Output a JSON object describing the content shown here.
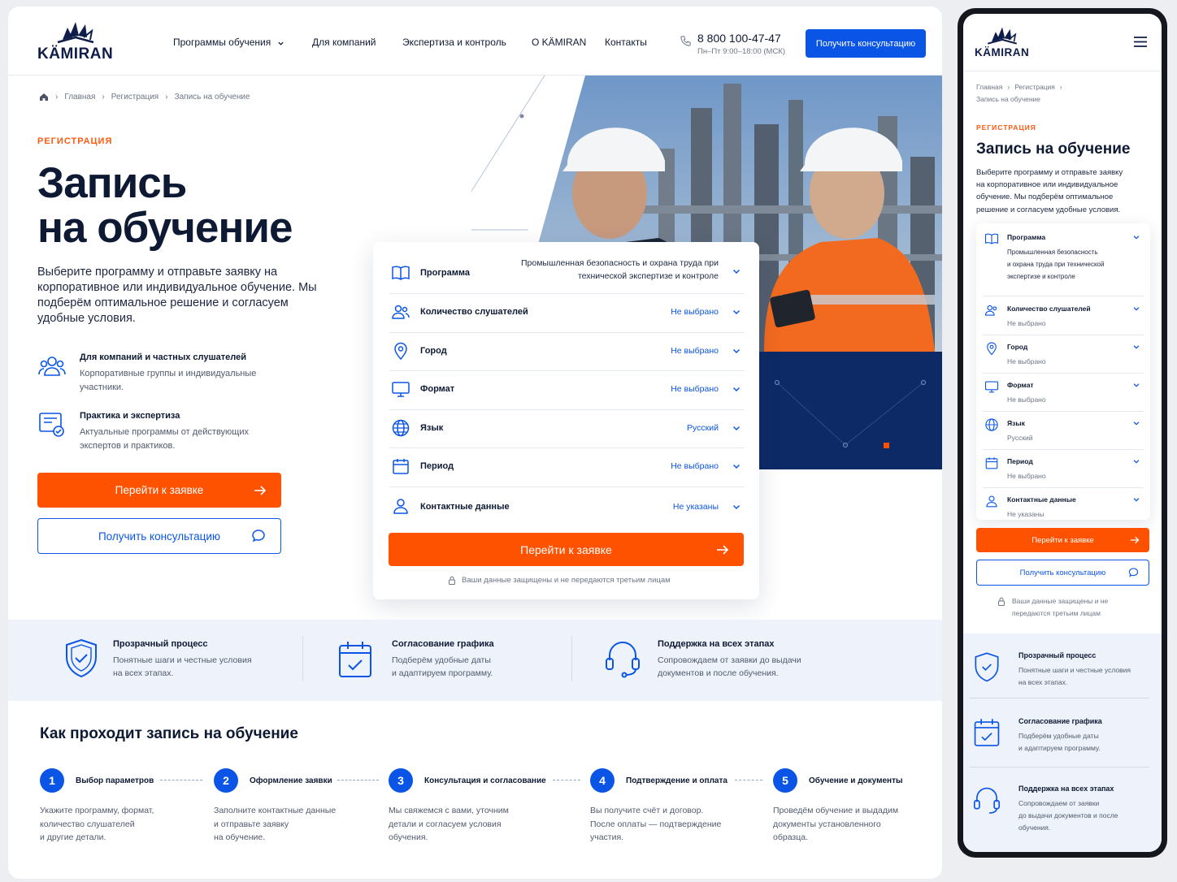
{
  "brand": {
    "name": "KÄMIRAN"
  },
  "header": {
    "nav": [
      "Программы обучения",
      "Для компаний",
      "Экспертиза и контроль",
      "О KÄMIRAN",
      "Контакты"
    ],
    "phone": "8 800 100-47-47",
    "hours": "Пн–Пт 9:00–18:00 (МСК)",
    "cta": "Получить консультацию"
  },
  "breadcrumbs": [
    "Главная",
    "Регистрация",
    "Запись на обучение"
  ],
  "hero": {
    "eyebrow": "РЕГИСТРАЦИЯ",
    "title_line1": "Запись",
    "title_line2": "на обучение",
    "description": "Выберите программу и отправьте заявку на корпоративное или индивидуальное обучение. Мы подберём оптимальное решение и согласуем удобные условия.",
    "features": [
      {
        "icon": "people-icon",
        "title": "Для компаний и частных слушателей",
        "text": "Корпоративные группы и индивидуальные участники."
      },
      {
        "icon": "certificate-icon",
        "title": "Практика и экспертиза",
        "text": "Актуальные программы от действующих экспертов и практиков."
      }
    ],
    "primary_button": "Перейти к заявке",
    "secondary_button": "Получить консультацию"
  },
  "form": {
    "rows": [
      {
        "icon": "book-icon",
        "label": "Программа",
        "value": "Промышленная безопасность и охрана труда при технической экспертизе и контроле"
      },
      {
        "icon": "users-icon",
        "label": "Количество слушателей",
        "value": "Не выбрано"
      },
      {
        "icon": "location-pin-icon",
        "label": "Город",
        "value": "Не выбрано"
      },
      {
        "icon": "monitor-icon",
        "label": "Формат",
        "value": "Не выбрано"
      },
      {
        "icon": "globe-icon",
        "label": "Язык",
        "value": "Русский"
      },
      {
        "icon": "calendar-icon",
        "label": "Период",
        "value": "Не выбрано"
      },
      {
        "icon": "user-icon",
        "label": "Контактные данные",
        "value": "Не указаны"
      }
    ],
    "submit": "Перейти к заявке",
    "secure_note": "Ваши данные защищены и не передаются третьим лицам"
  },
  "benefits": [
    {
      "icon": "shield-check-icon",
      "title": "Прозрачный процесс",
      "text_line1": "Понятные шаги и честные условия",
      "text_line2": "на всех этапах."
    },
    {
      "icon": "calendar-check-icon",
      "title": "Согласование графика",
      "text_line1": "Подберём удобные даты",
      "text_line2": "и адаптируем программу."
    },
    {
      "icon": "headset-icon",
      "title": "Поддержка на всех этапах",
      "text_line1": "Сопровождаем от заявки до выдачи",
      "text_line2": "документов и после обучения."
    }
  ],
  "steps": {
    "title": "Как проходит запись на обучение",
    "items": [
      {
        "num": "1",
        "title": "Выбор параметров",
        "lines": [
          "Укажите программу, формат,",
          "количество слушателей",
          "и другие детали."
        ]
      },
      {
        "num": "2",
        "title": "Оформление заявки",
        "lines": [
          "Заполните контактные данные",
          "и отправьте заявку",
          "на обучение."
        ]
      },
      {
        "num": "3",
        "title": "Консультация и согласование",
        "lines": [
          "Мы свяжемся с вами, уточним",
          "детали и согласуем условия",
          "обучения."
        ]
      },
      {
        "num": "4",
        "title": "Подтверждение и оплата",
        "lines": [
          "Вы получите счёт и договор.",
          "После оплаты — подтверждение",
          "участия."
        ]
      },
      {
        "num": "5",
        "title": "Обучение и документы",
        "lines": [
          "Проведём обучение и выдадим",
          "документы установленного",
          "образца."
        ]
      }
    ]
  },
  "mobile": {
    "description_lines": [
      "Выберите программу и отправьте заявку",
      "на корпоративное или индивидуальное",
      "обучение. Мы подберём оптимальное",
      "решение и согласуем удобные условия."
    ],
    "program_value_lines": [
      "Промышленная безопасность",
      "и охрана труда при технической",
      "экспертизе и контроле"
    ],
    "secure_lines": [
      "Ваши данные защищены и не",
      "передаются третьим лицам"
    ],
    "benefits": [
      {
        "lines": [
          "Понятные шаги и честные условия",
          "на всех этапах."
        ]
      },
      {
        "lines": [
          "Подберём удобные даты",
          "и адаптируем программу."
        ]
      },
      {
        "lines": [
          "Сопровождаем от заявки",
          "до выдачи документов и после",
          "обучения."
        ]
      }
    ]
  },
  "colors": {
    "accent": "#0a55e6",
    "orange": "#ff5200",
    "navy": "#0e1d49"
  }
}
